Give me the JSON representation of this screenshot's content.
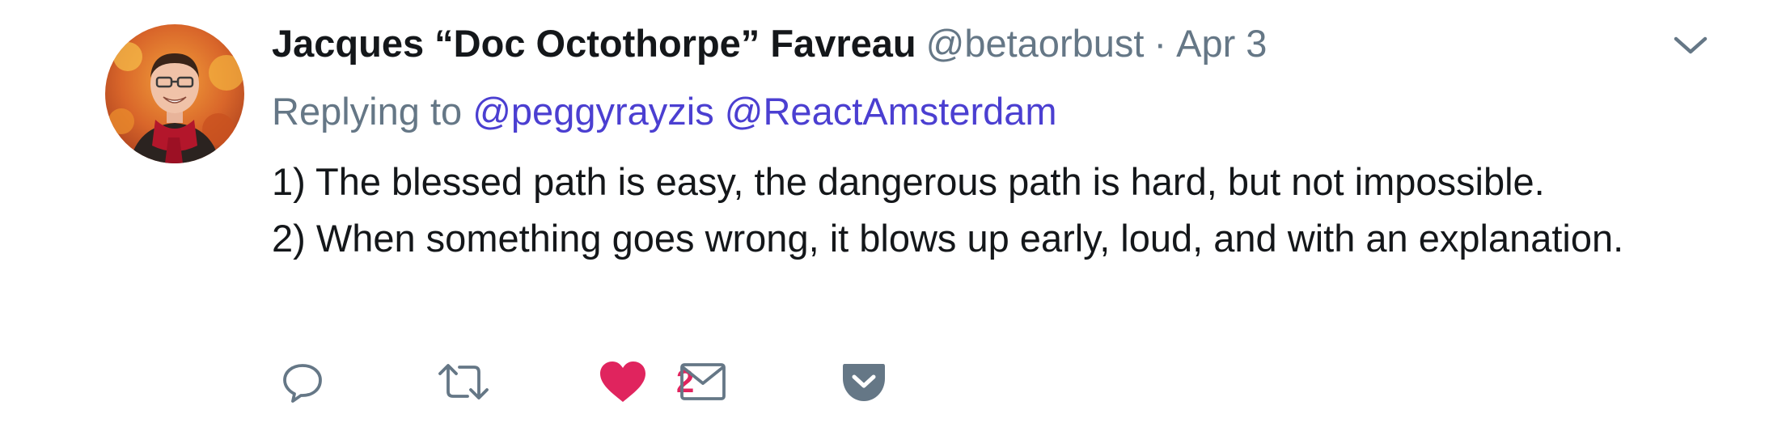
{
  "tweet": {
    "author": {
      "name": "Jacques “Doc Octothorpe” Favreau",
      "handle": "@betaorbust"
    },
    "separator": "·",
    "date": "Apr 3",
    "reply": {
      "prefix": "Replying to",
      "mentions": [
        "@peggyrayzis",
        "@ReactAmsterdam"
      ]
    },
    "text_lines": [
      "1) The blessed path is easy, the dangerous path is hard, but not impossible.",
      "2) When something goes wrong, it blows up early, loud, and with an explanation."
    ],
    "actions": {
      "reply_icon": "reply-icon",
      "retweet_icon": "retweet-icon",
      "like_icon": "heart-icon",
      "like_count": "2",
      "dm_icon": "envelope-icon",
      "save_icon": "pocket-icon"
    },
    "menu_icon": "chevron-down-icon",
    "colors": {
      "text": "#14171a",
      "muted": "#657786",
      "mention": "#4b3fd1",
      "like": "#e0245e"
    }
  }
}
